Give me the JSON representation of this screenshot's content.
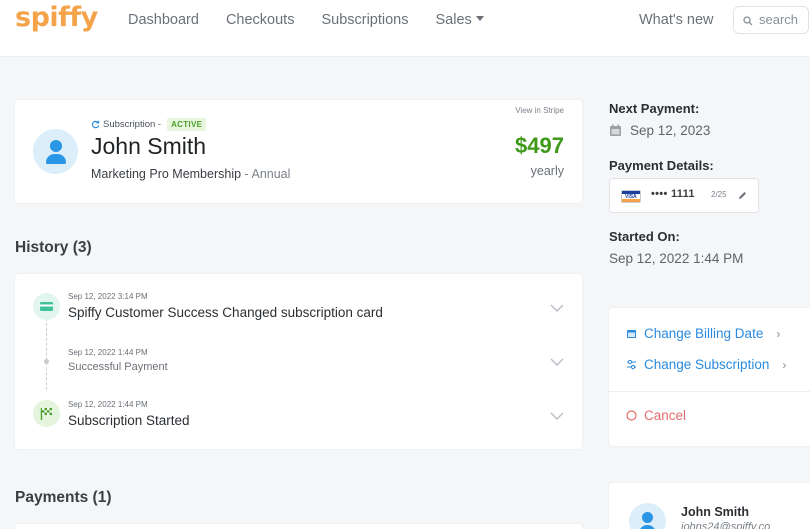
{
  "brand": {
    "logo": "spiffy",
    "accent": "#f4a34a"
  },
  "nav": {
    "items": [
      "Dashboard",
      "Checkouts",
      "Subscriptions",
      "Sales"
    ],
    "whats_new": "What's new",
    "search_placeholder": "search"
  },
  "subscription": {
    "type_label": "Subscription -",
    "status": "ACTIVE",
    "view_in_stripe": "View in Stripe",
    "customer_name": "John Smith",
    "plan_name": "Marketing Pro Membership",
    "plan_interval": "- Annual",
    "amount": "$497",
    "period": "yearly"
  },
  "history": {
    "title": "History (3)",
    "events": [
      {
        "time": "Sep 12, 2022 3:14 PM",
        "title": "Spiffy Customer Success Changed subscription card",
        "icon": "credit-card-icon"
      },
      {
        "time": "Sep 12, 2022 1:44 PM",
        "title": "Successful Payment",
        "icon": "dot-icon"
      },
      {
        "time": "Sep 12, 2022 1:44 PM",
        "title": "Subscription Started",
        "icon": "flag-icon"
      }
    ]
  },
  "payments": {
    "title": "Payments (1)"
  },
  "next_payment": {
    "label": "Next Payment:",
    "date": "Sep 12, 2023"
  },
  "payment_details": {
    "label": "Payment Details:",
    "card_brand": "VISA",
    "masked": "•••• 1111",
    "expiry": "2/25"
  },
  "started_on": {
    "label": "Started On:",
    "value": "Sep 12, 2022 1:44 PM"
  },
  "actions": {
    "change_billing_date": "Change Billing Date",
    "change_subscription": "Change Subscription",
    "cancel": "Cancel",
    "arrow": "›"
  },
  "customer_card": {
    "name": "John Smith",
    "email": "johns24@spiffy.co"
  }
}
